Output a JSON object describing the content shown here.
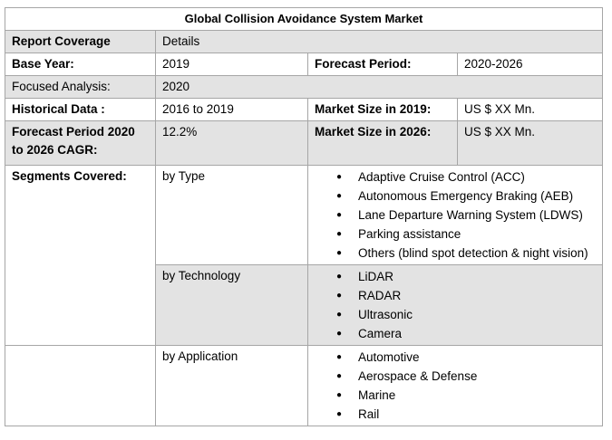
{
  "title": "Global Collision Avoidance System Market",
  "rows": {
    "coverage": {
      "label": "Report Coverage",
      "value": "Details"
    },
    "base_year": {
      "label": "Base Year:",
      "value": "2019",
      "label2": "Forecast Period:",
      "value2": "2020-2026"
    },
    "focused": {
      "label": "Focused Analysis:",
      "value": "2020"
    },
    "historical": {
      "label": "Historical Data :",
      "value": "2016 to 2019",
      "label2": "Market Size in 2019:",
      "value2": "US $ XX Mn."
    },
    "cagr": {
      "label": "Forecast Period 2020 to 2026 CAGR:",
      "value": "12.2%",
      "label2": "Market Size in 2026:",
      "value2": "US $ XX Mn."
    }
  },
  "segments": {
    "label": "Segments Covered:",
    "groups": [
      {
        "name": "by Type",
        "items": [
          "Adaptive Cruise Control (ACC)",
          "Autonomous Emergency Braking (AEB)",
          "Lane Departure Warning System (LDWS)",
          "Parking assistance",
          "Others (blind spot detection & night vision)"
        ]
      },
      {
        "name": "by Technology",
        "items": [
          "LiDAR",
          "RADAR",
          "Ultrasonic",
          "Camera"
        ]
      },
      {
        "name": "by Application",
        "items": [
          "Automotive",
          "Aerospace & Defense",
          "Marine",
          "Rail"
        ]
      }
    ]
  }
}
